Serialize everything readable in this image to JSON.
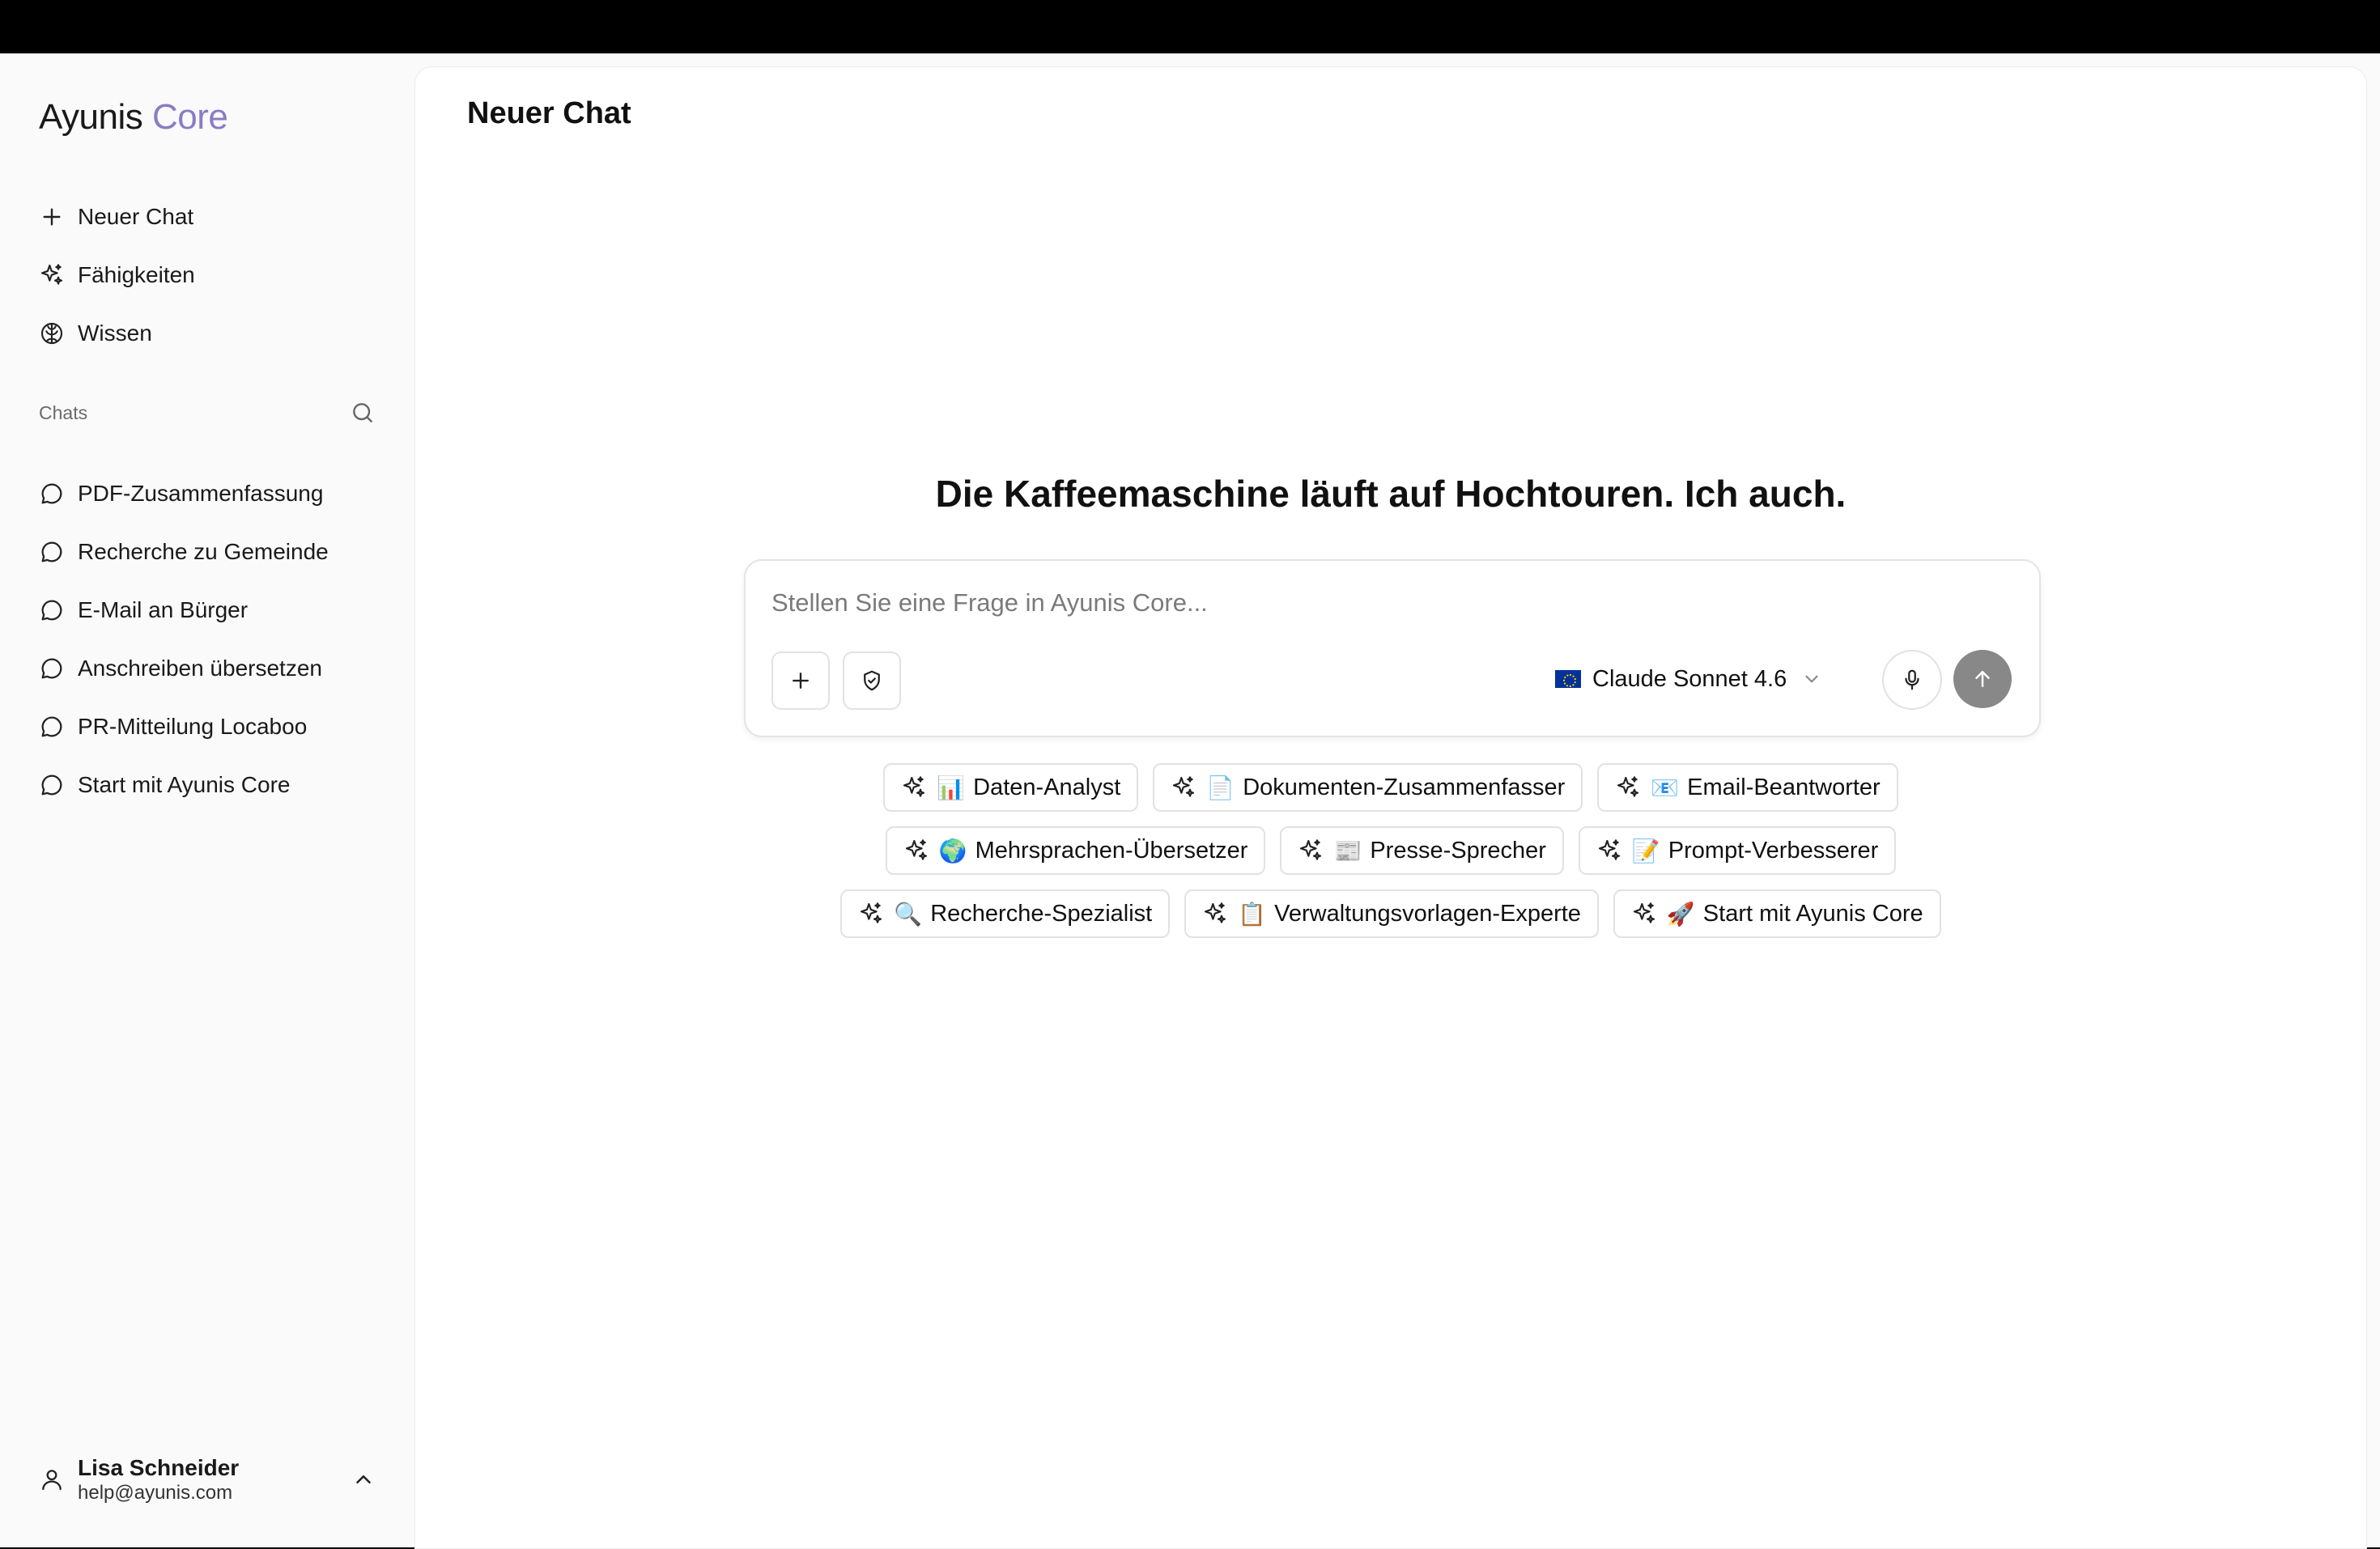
{
  "brand": {
    "name_part1": "Ayunis",
    "name_part2": "Core"
  },
  "nav": [
    {
      "label": "Neuer Chat",
      "icon": "plus-icon"
    },
    {
      "label": "Fähigkeiten",
      "icon": "sparkles-icon"
    },
    {
      "label": "Wissen",
      "icon": "brain-icon"
    }
  ],
  "chats": {
    "label": "Chats",
    "items": [
      "PDF-Zusammenfassung",
      "Recherche zu Gemeinde",
      "E-Mail an Bürger",
      "Anschreiben übersetzen",
      "PR-Mitteilung Locaboo",
      "Start mit Ayunis Core"
    ]
  },
  "user": {
    "name": "Lisa Schneider",
    "email": "help@ayunis.com"
  },
  "main": {
    "title": "Neuer Chat",
    "headline": "Die Kaffeemaschine läuft auf Hochtouren. Ich auch."
  },
  "composer": {
    "placeholder": "Stellen Sie eine Frage in Ayunis Core...",
    "model": "Claude Sonnet 4.6",
    "model_flag": "eu-flag-icon"
  },
  "skills": [
    [
      {
        "emoji": "📊",
        "label": "Daten-Analyst"
      },
      {
        "emoji": "📄",
        "label": "Dokumenten-Zusammenfasser"
      },
      {
        "emoji": "📧",
        "label": "Email-Beantworter"
      }
    ],
    [
      {
        "emoji": "🌍",
        "label": "Mehrsprachen-Übersetzer"
      },
      {
        "emoji": "📰",
        "label": "Presse-Sprecher"
      },
      {
        "emoji": "📝",
        "label": "Prompt-Verbesserer"
      }
    ],
    [
      {
        "emoji": "🔍",
        "label": "Recherche-Spezialist"
      },
      {
        "emoji": "📋",
        "label": "Verwaltungsvorlagen-Experte"
      },
      {
        "emoji": "🚀",
        "label": "Start mit Ayunis Core"
      }
    ]
  ],
  "colors": {
    "brand_accent": "#8a7cc4",
    "send_button": "#888888"
  }
}
